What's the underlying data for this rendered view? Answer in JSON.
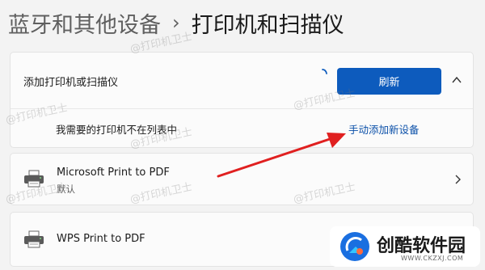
{
  "breadcrumb": {
    "parent": "蓝牙和其他设备",
    "separator": "›",
    "current": "打印机和扫描仪"
  },
  "add_group": {
    "title": "添加打印机或扫描仪",
    "refresh_label": "刷新",
    "missing_text": "我需要的打印机不在列表中",
    "manual_add_link": "手动添加新设备"
  },
  "devices": [
    {
      "name": "Microsoft Print to PDF",
      "status": "默认"
    },
    {
      "name": "WPS Print to PDF"
    }
  ],
  "watermark": "@打印机卫士",
  "logo": {
    "name": "创酷软件园",
    "url": "WWW.CKZXJ.COM"
  },
  "colors": {
    "accent": "#0d5bbd",
    "link": "#0a4fa8",
    "arrow": "#e02020"
  }
}
